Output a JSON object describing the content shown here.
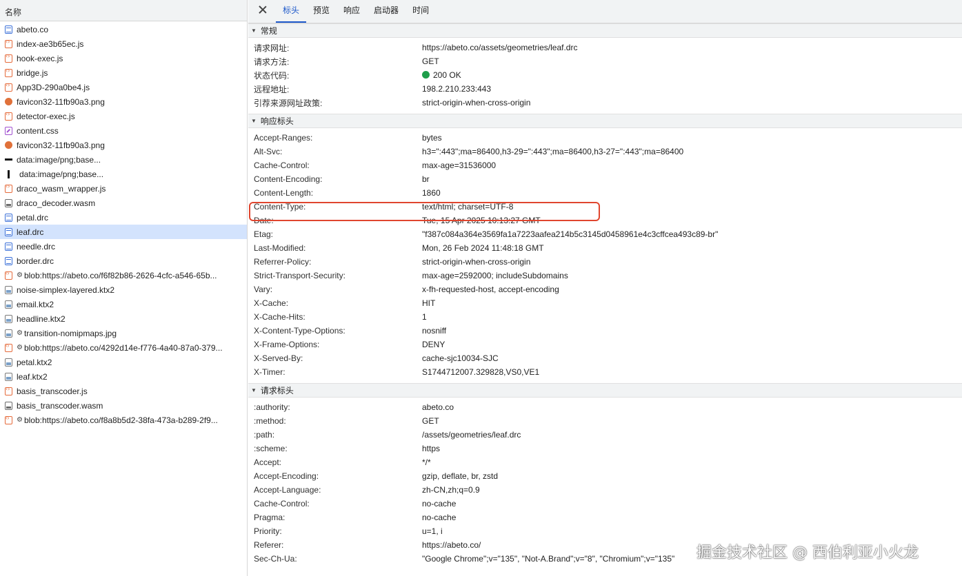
{
  "request_list": {
    "header": "名称",
    "items": [
      {
        "name": "abeto.co",
        "icon": "doc-icon"
      },
      {
        "name": "index-ae3b65ec.js",
        "icon": "script-icon"
      },
      {
        "name": "hook-exec.js",
        "icon": "script-icon"
      },
      {
        "name": "bridge.js",
        "icon": "script-icon"
      },
      {
        "name": "App3D-290a0be4.js",
        "icon": "script-icon"
      },
      {
        "name": "favicon32-11fb90a3.png",
        "icon": "image-icon"
      },
      {
        "name": "detector-exec.js",
        "icon": "script-icon"
      },
      {
        "name": "content.css",
        "icon": "css-icon"
      },
      {
        "name": "favicon32-11fb90a3.png",
        "icon": "image-icon"
      },
      {
        "name": "data:image/png;base...",
        "icon": "data-image-icon"
      },
      {
        "name": "data:image/png;base...",
        "icon": "data-image-icon"
      },
      {
        "name": "draco_wasm_wrapper.js",
        "icon": "script-icon"
      },
      {
        "name": "draco_decoder.wasm",
        "icon": "wasm-icon"
      },
      {
        "name": "petal.drc",
        "icon": "doc-icon"
      },
      {
        "name": "leaf.drc",
        "icon": "doc-icon",
        "selected": true
      },
      {
        "name": "needle.drc",
        "icon": "doc-icon"
      },
      {
        "name": "border.drc",
        "icon": "doc-icon"
      },
      {
        "name": "blob:https://abeto.co/f6f82b86-2626-4cfc-a546-65b...",
        "icon": "blob-script-icon",
        "gear": true
      },
      {
        "name": "noise-simplex-layered.ktx2",
        "icon": "texture-icon"
      },
      {
        "name": "email.ktx2",
        "icon": "texture-icon"
      },
      {
        "name": "headline.ktx2",
        "icon": "texture-icon"
      },
      {
        "name": "transition-nomipmaps.jpg",
        "icon": "texture-icon",
        "gear": true
      },
      {
        "name": "blob:https://abeto.co/4292d14e-f776-4a40-87a0-379...",
        "icon": "blob-script-icon",
        "gear": true
      },
      {
        "name": "petal.ktx2",
        "icon": "texture-icon"
      },
      {
        "name": "leaf.ktx2",
        "icon": "texture-icon"
      },
      {
        "name": "basis_transcoder.js",
        "icon": "script-icon"
      },
      {
        "name": "basis_transcoder.wasm",
        "icon": "wasm-icon"
      },
      {
        "name": "blob:https://abeto.co/f8a8b5d2-38fa-473a-b289-2f9...",
        "icon": "blob-script-icon",
        "gear": true
      }
    ]
  },
  "tabs": [
    "标头",
    "预览",
    "响应",
    "启动器",
    "时间"
  ],
  "active_tab": "标头",
  "general": {
    "title": "常规",
    "rows": [
      {
        "k": "请求网址:",
        "v": "https://abeto.co/assets/geometries/leaf.drc"
      },
      {
        "k": "请求方法:",
        "v": "GET"
      },
      {
        "k": "状态代码:",
        "v": "200 OK",
        "status_dot": true
      },
      {
        "k": "远程地址:",
        "v": "198.2.210.233:443"
      },
      {
        "k": "引荐来源网址政策:",
        "v": "strict-origin-when-cross-origin"
      }
    ]
  },
  "response_headers": {
    "title": "响应标头",
    "rows": [
      {
        "k": "Accept-Ranges:",
        "v": "bytes"
      },
      {
        "k": "Alt-Svc:",
        "v": "h3=\":443\";ma=86400,h3-29=\":443\";ma=86400,h3-27=\":443\";ma=86400"
      },
      {
        "k": "Cache-Control:",
        "v": "max-age=31536000"
      },
      {
        "k": "Content-Encoding:",
        "v": "br"
      },
      {
        "k": "Content-Length:",
        "v": "1860"
      },
      {
        "k": "Content-Type:",
        "v": "text/html; charset=UTF-8",
        "highlight": true
      },
      {
        "k": "Date:",
        "v": "Tue, 15 Apr 2025 10:13:27 GMT"
      },
      {
        "k": "Etag:",
        "v": "\"f387c084a364e3569fa1a7223aafea214b5c3145d0458961e4c3cffcea493c89-br\""
      },
      {
        "k": "Last-Modified:",
        "v": "Mon, 26 Feb 2024 11:48:18 GMT"
      },
      {
        "k": "Referrer-Policy:",
        "v": "strict-origin-when-cross-origin"
      },
      {
        "k": "Strict-Transport-Security:",
        "v": "max-age=2592000; includeSubdomains"
      },
      {
        "k": "Vary:",
        "v": "x-fh-requested-host, accept-encoding"
      },
      {
        "k": "X-Cache:",
        "v": "HIT"
      },
      {
        "k": "X-Cache-Hits:",
        "v": "1"
      },
      {
        "k": "X-Content-Type-Options:",
        "v": "nosniff"
      },
      {
        "k": "X-Frame-Options:",
        "v": "DENY"
      },
      {
        "k": "X-Served-By:",
        "v": "cache-sjc10034-SJC"
      },
      {
        "k": "X-Timer:",
        "v": "S1744712007.329828,VS0,VE1"
      }
    ]
  },
  "request_headers": {
    "title": "请求标头",
    "rows": [
      {
        "k": ":authority:",
        "v": "abeto.co"
      },
      {
        "k": ":method:",
        "v": "GET"
      },
      {
        "k": ":path:",
        "v": "/assets/geometries/leaf.drc"
      },
      {
        "k": ":scheme:",
        "v": "https"
      },
      {
        "k": "Accept:",
        "v": "*/*"
      },
      {
        "k": "Accept-Encoding:",
        "v": "gzip, deflate, br, zstd"
      },
      {
        "k": "Accept-Language:",
        "v": "zh-CN,zh;q=0.9"
      },
      {
        "k": "Cache-Control:",
        "v": "no-cache"
      },
      {
        "k": "Pragma:",
        "v": "no-cache"
      },
      {
        "k": "Priority:",
        "v": "u=1, i"
      },
      {
        "k": "Referer:",
        "v": "https://abeto.co/"
      },
      {
        "k": "Sec-Ch-Ua:",
        "v": "\"Google Chrome\";v=\"135\", \"Not-A.Brand\";v=\"8\", \"Chromium\";v=\"135\""
      }
    ]
  },
  "watermark": "掘金技术社区 @ 西伯利亚小火龙",
  "colors": {
    "accent": "#1a56c9",
    "selected_row": "#d3e3fd",
    "status_ok": "#1e9e4a",
    "highlight_box": "#e0452e"
  }
}
